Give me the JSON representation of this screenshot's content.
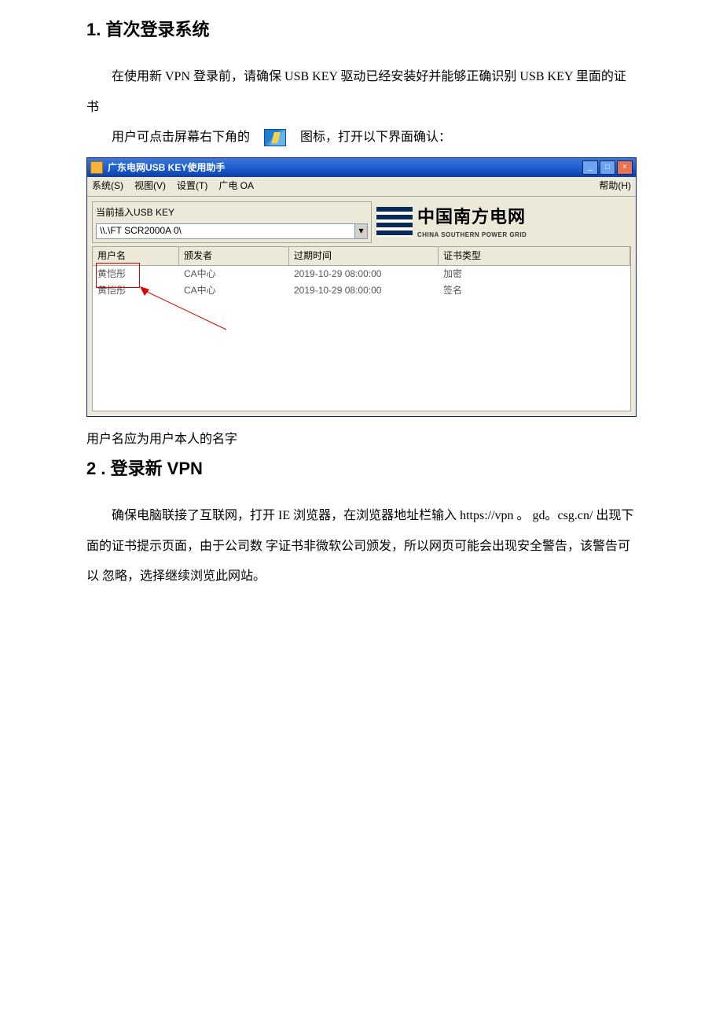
{
  "sections": {
    "s1": {
      "heading": "1. 首次登录系统",
      "p1": "在使用新 VPN 登录前，请确保 USB KEY 驱动已经安装好并能够正确识别 USB KEY 里面的证书",
      "p2a": "用户可点击屏幕右下角的",
      "p2b": "图标，打开以下界面确认：",
      "caption": "用户名应为用户本人的名字"
    },
    "s2": {
      "heading": "2 . 登录新 VPN",
      "p1": "确保电脑联接了互联网，打开 IE 浏览器，在浏览器地址栏输入 https://vpn 。 gd。csg.cn/ 出现下面的证书提示页面，由于公司数 字证书非微软公司颁发，所以网页可能会出现安全警告，该警告可以 忽略，选择继续浏览此网站。"
    }
  },
  "xpwin": {
    "title": "广东电网USB KEY使用助手",
    "menus": {
      "system": "系统(S)",
      "view": "视图(V)",
      "settings": "设置(T)",
      "oa": "广电 OA",
      "help": "帮助(H)"
    },
    "usb_label": "当前插入USB KEY",
    "combo_value": "\\\\.\\FT SCR2000A 0\\",
    "logo_cn": "中国南方电网",
    "logo_en": "CHINA SOUTHERN POWER GRID",
    "columns": {
      "user": "用户名",
      "issuer": "颁发者",
      "expire": "过期时间",
      "type": "证书类型"
    },
    "rows": [
      {
        "user": "黄恺彤",
        "issuer": "CA中心",
        "expire": "2019-10-29 08:00:00",
        "type": "加密"
      },
      {
        "user": "黄恺彤",
        "issuer": "CA中心",
        "expire": "2019-10-29 08:00:00",
        "type": "签名"
      }
    ]
  }
}
